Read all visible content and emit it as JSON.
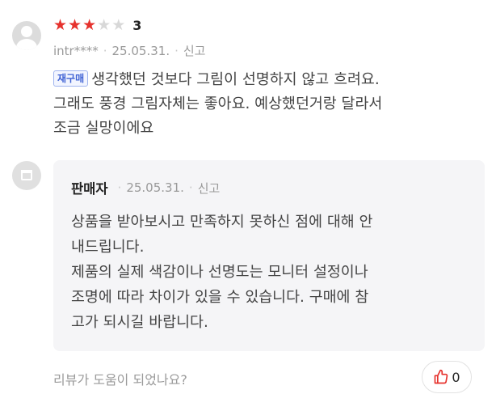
{
  "review": {
    "rating": 3,
    "max_rating": 5,
    "rating_label": "3",
    "user_id": "intr****",
    "date": "25.05.31.",
    "report_label": "신고",
    "badge": "재구매",
    "text_lines": [
      "생각했던 것보다 그림이 선명하지 않고 흐려요.",
      "그래도 풍경 그림자체는 좋아요. 예상했던거랑 달라서",
      "조금 실망이에요"
    ]
  },
  "reply": {
    "author": "판매자",
    "date": "25.05.31.",
    "report_label": "신고",
    "text_lines": [
      "상품을 받아보시고 만족하지 못하신 점에 대해 안",
      "내드립니다.",
      "제품의 실제 색감이나 선명도는 모니터 설정이나",
      "조명에 따라 차이가 있을 수 있습니다. 구매에 참",
      "고가 되시길 바랍니다."
    ]
  },
  "helpful": {
    "question": "리뷰가 도움이 되었나요?",
    "like_count": "0"
  },
  "colors": {
    "star_on": "#e6322d",
    "star_off": "#d8d8d8",
    "badge": "#3f62d4",
    "like_icon": "#e6322d"
  },
  "icons": {
    "user_avatar": "user-avatar-icon",
    "seller_avatar": "shop-icon",
    "like": "thumbs-up-icon",
    "star": "star-icon"
  }
}
